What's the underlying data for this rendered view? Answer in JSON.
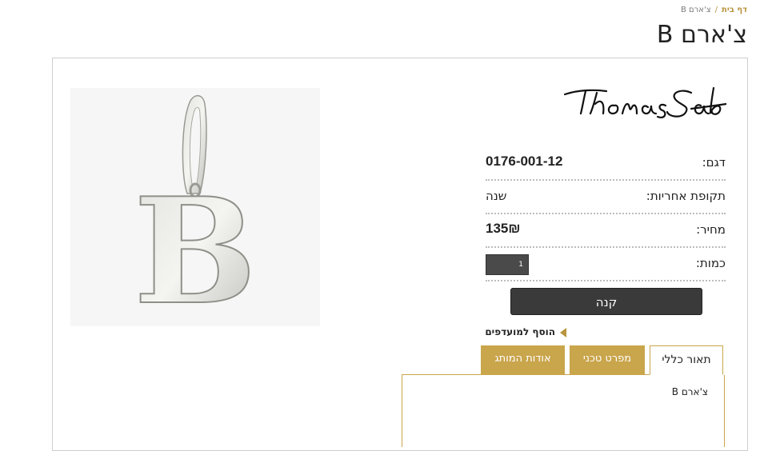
{
  "breadcrumb": {
    "home": "דף בית",
    "separator": "/",
    "current": "צ'ארם B"
  },
  "page_title": "צ'ארם B",
  "brand": {
    "name": "Thomas Sabo"
  },
  "product": {
    "image_letter": "B",
    "model_label": "דגם:",
    "model_value": "0176-001-12",
    "warranty_label": "תקופת אחריות:",
    "warranty_value": "שנה",
    "price_label": "מחיר:",
    "price_value": "135₪",
    "quantity_label": "כמות:",
    "quantity_value": "1"
  },
  "actions": {
    "buy": "קנה",
    "wishlist": "הוסף למועדפים"
  },
  "tabs": [
    {
      "label": "תאור כללי",
      "active": true
    },
    {
      "label": "מפרט טכני",
      "active": false
    },
    {
      "label": "אודות המותג",
      "active": false
    }
  ],
  "tab_content": {
    "text": "צ'ארם B"
  },
  "colors": {
    "accent_gold": "#c9a54b",
    "button_dark": "#3a3a3a"
  }
}
